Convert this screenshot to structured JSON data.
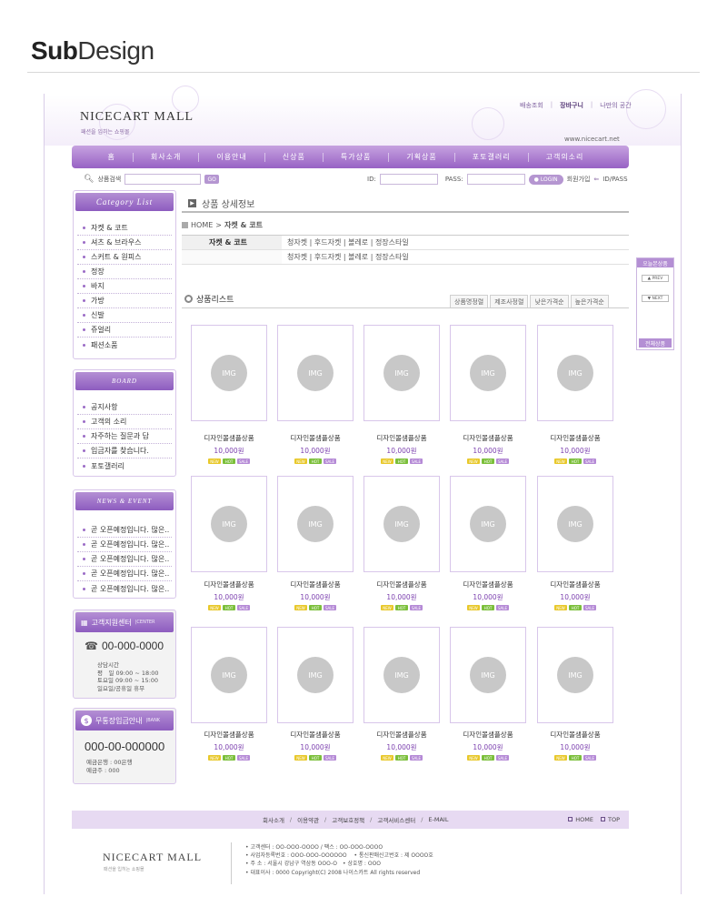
{
  "header": {
    "sub": "Sub",
    "design": "Design"
  },
  "util_links": [
    "배송조회",
    "장바구니",
    "나만의 공간"
  ],
  "logo": "NICECART MALL",
  "tagline": "패션을 입히는 쇼핑몰",
  "url": "www.nicecart.net",
  "gnb": [
    "홈",
    "회사소개",
    "이용안내",
    "신상품",
    "특가상품",
    "기획상품",
    "포토갤러리",
    "고객의소리"
  ],
  "search": {
    "label": "상품검색",
    "go": "GO"
  },
  "login": {
    "id_label": "ID:",
    "pass_label": "PASS:",
    "login_btn": "LOGIN",
    "join": "회원가입",
    "find": "ID/PASS"
  },
  "category": {
    "title": "Category List",
    "items": [
      "자켓 & 코트",
      "셔츠 & 브라우스",
      "스커트 & 원피스",
      "정장",
      "바지",
      "가방",
      "신발",
      "쥬얼리",
      "패션소품"
    ]
  },
  "board": {
    "title": "BOARD",
    "items": [
      "공지사항",
      "고객의 소리",
      "자주하는 질문과 답",
      "입금자를 찾습니다.",
      "포토갤러리"
    ]
  },
  "news": {
    "title": "NEWS & EVENT",
    "items": [
      "곧 오픈예정입니다. 많은..",
      "곧 오픈예정입니다. 많은..",
      "곧 오픈예정입니다. 많은..",
      "곧 오픈예정입니다. 많은..",
      "곧 오픈예정입니다. 많은.."
    ]
  },
  "cs": {
    "title": "고객지원센터",
    "sub": "CENTER",
    "phone": "00-000-0000",
    "hours_title": "상담시간",
    "weekday": "평　일 09:00 ~ 18:00",
    "saturday": "토요일 09:00 ~ 15:00",
    "holiday": "일요일/공휴일 휴무"
  },
  "bank": {
    "title": "무통장입금안내",
    "sub": "BANK",
    "account": "000-00-000000",
    "bank_name": "예금은행 : 00은행",
    "holder": "예금주 : 000"
  },
  "content": {
    "title": "상품 상세정보",
    "crumb_home": "HOME",
    "crumb_sep": ">",
    "crumb_current": "자켓 & 코트",
    "cat_label": "자켓 & 코트",
    "cat_links_1": "청자켓 | 후드자켓 | 볼레로 | 정장스타일",
    "cat_links_2": "청자켓 | 후드자켓 | 볼레로 | 정장스타일",
    "list_title": "상품리스트",
    "sort_tabs": [
      "상품명정렬",
      "제조사정렬",
      "낮은가격순",
      "높은가격순"
    ]
  },
  "product": {
    "img": "IMG",
    "name": "디자인몰샘플상품",
    "price": "10,000원",
    "badges": [
      "NEW",
      "HOT",
      "SALE"
    ]
  },
  "quick": {
    "title": "오늘본상품",
    "prev": "PREV",
    "next": "NEXT",
    "all": "전체상품"
  },
  "footer": {
    "menu": [
      "회사소개",
      "이용약관",
      "고객보호정책",
      "고객서비스센터",
      "E-MAIL"
    ],
    "home": "HOME",
    "top": "TOP",
    "logo": "NICECART MALL",
    "tagline": "패션을 입히는 쇼핑몰",
    "info": [
      "• 고객센터 : OO-OOO-OOOO / 팩스 : OO-OOO-OOOO",
      "• 사업자등록번호 : OOO-OOO-OOOOOO　 • 통신판매신고번호 : 제 OOOO호",
      "• 주 소 : 서울시 강남구 역삼동 OOO-O　• 상호명 : OOO",
      "• 대표이사 : 0000 Copyright(C) 2008 나이스카트 All rights reserved"
    ]
  }
}
